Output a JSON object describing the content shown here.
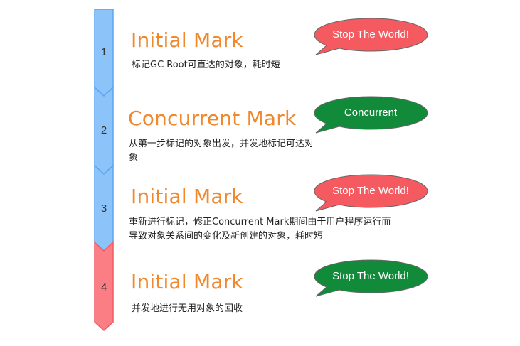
{
  "steps": [
    {
      "number": "1",
      "title": "Initial Mark",
      "description": "标记GC Root可直达的对象，耗时短",
      "bubble": "Stop The World!",
      "bubble_color": "#f55a60",
      "segment_color": "#8cc4fa"
    },
    {
      "number": "2",
      "title": "Concurrent Mark",
      "description": "从第一步标记的对象出发，并发地标记可达对象",
      "bubble": "Concurrent",
      "bubble_color": "#118a3a",
      "segment_color": "#8cc4fa"
    },
    {
      "number": "3",
      "title": "Initial Mark",
      "description": "重新进行标记，修正Concurrent Mark期间由于用户程序运行而导致对象关系间的变化及新创建的对象，耗时短",
      "bubble": "Stop The World!",
      "bubble_color": "#f55a60",
      "segment_color": "#8cc4fa"
    },
    {
      "number": "4",
      "title": "Initial Mark",
      "description": "并发地进行无用对象的回收",
      "bubble": "Stop The World!",
      "bubble_color": "#118a3a",
      "segment_color": "#fb7e84"
    }
  ]
}
